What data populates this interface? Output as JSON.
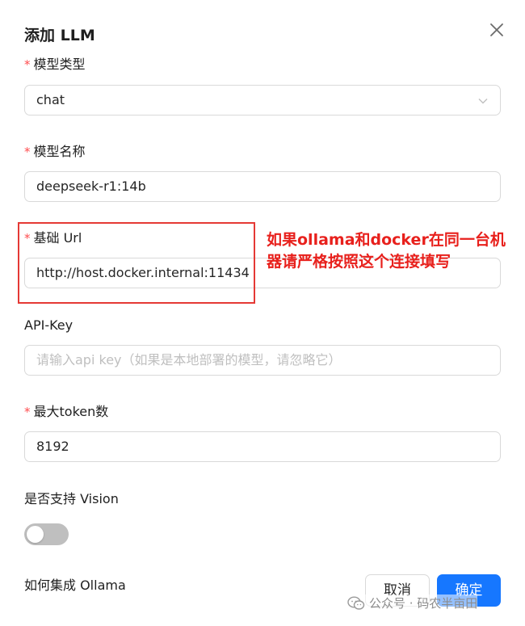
{
  "dialog": {
    "title": "添加 LLM",
    "close_icon": "close-icon"
  },
  "form": {
    "required_mark": "*",
    "model_type": {
      "label": "模型类型",
      "value": "chat",
      "icon": "chevron-down-icon"
    },
    "model_name": {
      "label": "模型名称",
      "value": "deepseek-r1:14b"
    },
    "base_url": {
      "label": "基础 Url",
      "value": "http://host.docker.internal:11434"
    },
    "api_key": {
      "label": "API-Key",
      "placeholder": "请输入api key（如果是本地部署的模型，请忽略它）"
    },
    "max_tokens": {
      "label": "最大token数",
      "value": "8192"
    },
    "vision": {
      "label": "是否支持 Vision",
      "enabled": false
    },
    "ollama_link": "如何集成 Ollama"
  },
  "buttons": {
    "cancel": "取消",
    "ok": "确定"
  },
  "annotation": {
    "text": "如果ollama和docker在同一台机器请严格按照这个连接填写",
    "color": "#e8201c"
  },
  "watermark": {
    "text": "公众号 · 码农半亩田",
    "icon": "wechat-icon"
  },
  "colors": {
    "primary": "#1677ff",
    "required": "#ff4d4f",
    "annotation_box": "#e53935"
  }
}
